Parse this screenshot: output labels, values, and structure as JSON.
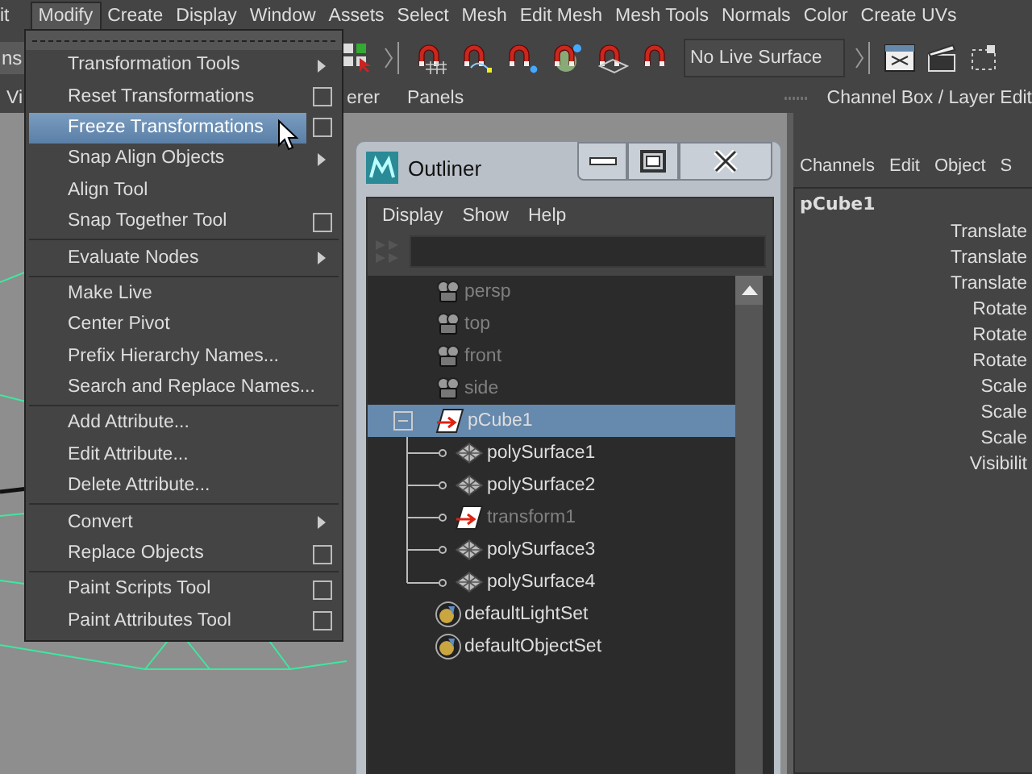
{
  "menu_bar": [
    {
      "label": "it",
      "selected": false
    },
    {
      "label": "Modify",
      "selected": true
    },
    {
      "label": "Create",
      "selected": false
    },
    {
      "label": "Display",
      "selected": false
    },
    {
      "label": "Window",
      "selected": false
    },
    {
      "label": "Assets",
      "selected": false
    },
    {
      "label": "Select",
      "selected": false
    },
    {
      "label": "Mesh",
      "selected": false
    },
    {
      "label": "Edit Mesh",
      "selected": false
    },
    {
      "label": "Mesh Tools",
      "selected": false
    },
    {
      "label": "Normals",
      "selected": false
    },
    {
      "label": "Color",
      "selected": false
    },
    {
      "label": "Create UVs",
      "selected": false
    }
  ],
  "toolbar": {
    "left_field": "ns",
    "live_surface": "No Live Surface"
  },
  "panel_menu": {
    "left": "Vi",
    "middle": "erer",
    "panels": "Panels",
    "channel_box_title": "Channel Box / Layer Edit"
  },
  "modify_menu": {
    "groups": [
      [
        {
          "label": "Transformation Tools",
          "kind": "submenu",
          "selected": false
        },
        {
          "label": "Reset Transformations",
          "kind": "option",
          "selected": false
        },
        {
          "label": "Freeze Transformations",
          "kind": "option",
          "selected": true
        },
        {
          "label": "Snap Align Objects",
          "kind": "submenu",
          "selected": false
        },
        {
          "label": "Align Tool",
          "kind": "plain",
          "selected": false
        },
        {
          "label": "Snap Together Tool",
          "kind": "option",
          "selected": false
        }
      ],
      [
        {
          "label": "Evaluate Nodes",
          "kind": "submenu",
          "selected": false
        }
      ],
      [
        {
          "label": "Make Live",
          "kind": "plain",
          "selected": false
        },
        {
          "label": "Center Pivot",
          "kind": "plain",
          "selected": false
        },
        {
          "label": "Prefix Hierarchy Names...",
          "kind": "plain",
          "selected": false
        },
        {
          "label": "Search and Replace Names...",
          "kind": "plain",
          "selected": false
        }
      ],
      [
        {
          "label": "Add Attribute...",
          "kind": "plain",
          "selected": false
        },
        {
          "label": "Edit Attribute...",
          "kind": "plain",
          "selected": false
        },
        {
          "label": "Delete Attribute...",
          "kind": "plain",
          "selected": false
        }
      ],
      [
        {
          "label": "Convert",
          "kind": "submenu",
          "selected": false
        },
        {
          "label": "Replace Objects",
          "kind": "option",
          "selected": false
        }
      ],
      [
        {
          "label": "Paint Scripts Tool",
          "kind": "option",
          "selected": false
        },
        {
          "label": "Paint Attributes Tool",
          "kind": "option",
          "selected": false
        }
      ]
    ]
  },
  "outliner": {
    "title": "Outliner",
    "menus": [
      "Display",
      "Show",
      "Help"
    ],
    "items": [
      {
        "label": "persp",
        "kind": "camera",
        "dimmed": true,
        "selected": false
      },
      {
        "label": "top",
        "kind": "camera",
        "dimmed": true,
        "selected": false
      },
      {
        "label": "front",
        "kind": "camera",
        "dimmed": true,
        "selected": false
      },
      {
        "label": "side",
        "kind": "camera",
        "dimmed": true,
        "selected": false
      },
      {
        "label": "pCube1",
        "kind": "transform",
        "dimmed": false,
        "selected": true,
        "expanded": true,
        "children": [
          {
            "label": "polySurface1",
            "kind": "mesh",
            "dimmed": false,
            "selected": false
          },
          {
            "label": "polySurface2",
            "kind": "mesh",
            "dimmed": false,
            "selected": false
          },
          {
            "label": "transform1",
            "kind": "transform",
            "dimmed": true,
            "selected": false
          },
          {
            "label": "polySurface3",
            "kind": "mesh",
            "dimmed": false,
            "selected": false
          },
          {
            "label": "polySurface4",
            "kind": "mesh",
            "dimmed": false,
            "selected": false
          }
        ]
      },
      {
        "label": "defaultLightSet",
        "kind": "set",
        "dimmed": false,
        "selected": false
      },
      {
        "label": "defaultObjectSet",
        "kind": "set",
        "dimmed": false,
        "selected": false
      }
    ]
  },
  "channel_box": {
    "menus": [
      "Channels",
      "Edit",
      "Object",
      "S"
    ],
    "object": "pCube1",
    "attributes": [
      "Translate",
      "Translate",
      "Translate",
      "Rotate",
      "Rotate",
      "Rotate",
      "Scale",
      "Scale",
      "Scale",
      "Visibilit"
    ]
  }
}
